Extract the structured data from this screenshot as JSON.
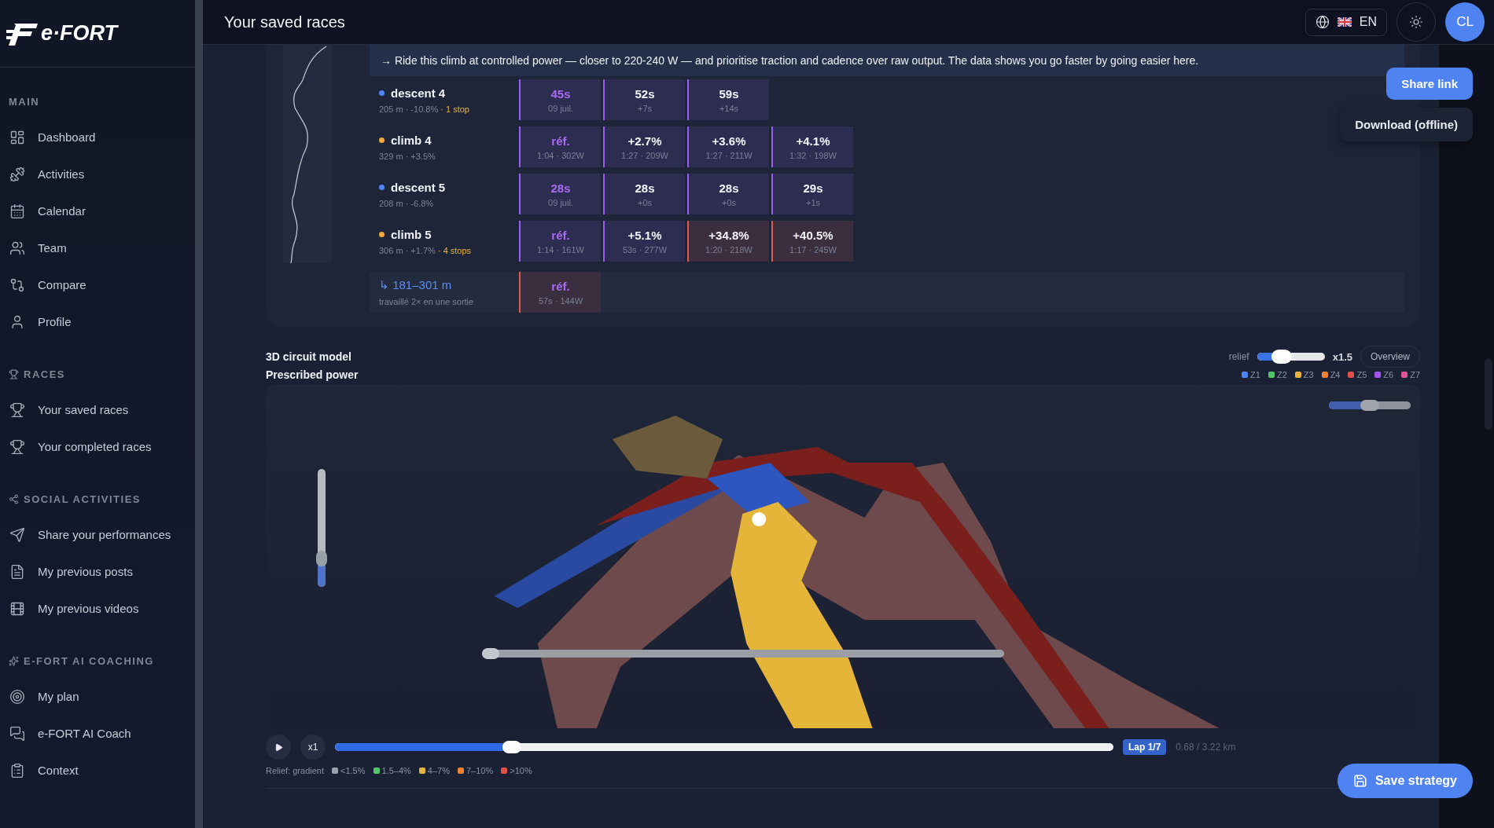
{
  "logo": "e·FORT",
  "header": {
    "title": "Your saved races",
    "language": "EN",
    "avatar": "CL"
  },
  "sidebar": {
    "sections": [
      {
        "title": "MAIN",
        "items": [
          {
            "label": "Dashboard"
          },
          {
            "label": "Activities"
          },
          {
            "label": "Calendar"
          },
          {
            "label": "Team"
          },
          {
            "label": "Compare"
          },
          {
            "label": "Profile"
          }
        ]
      },
      {
        "title": "RACES",
        "items": [
          {
            "label": "Your saved races"
          },
          {
            "label": "Your completed races"
          }
        ]
      },
      {
        "title": "SOCIAL ACTIVITIES",
        "items": [
          {
            "label": "Share your performances"
          },
          {
            "label": "My previous posts"
          },
          {
            "label": "My previous videos"
          }
        ]
      },
      {
        "title": "E-FORT AI COACHING",
        "items": [
          {
            "label": "My plan"
          },
          {
            "label": "e-FORT AI Coach"
          },
          {
            "label": "Context"
          }
        ]
      }
    ]
  },
  "advice": "→ Ride this climb at controlled power — closer to 220-240 W — and prioritise traction and cadence over raw output. The data shows you go faster by going easier here.",
  "segments": [
    {
      "kind": "segment",
      "name": "descent 4",
      "color": "#4f83f1",
      "meta": "205 m · -10.8%",
      "stops": "· 1 stop",
      "cells": [
        {
          "value": "45s",
          "sub": "09 juil.",
          "reference": true,
          "warning": false
        },
        {
          "value": "52s",
          "sub": "+7s",
          "reference": false,
          "warning": false
        },
        {
          "value": "59s",
          "sub": "+14s",
          "reference": false,
          "warning": false
        }
      ]
    },
    {
      "kind": "segment",
      "name": "climb 4",
      "color": "#f0a93b",
      "meta": "329 m · +3.5%",
      "cells": [
        {
          "value": "réf.",
          "sub": "1:04 · 302W",
          "reference": true,
          "warning": false
        },
        {
          "value": "+2.7%",
          "sub": "1:27 · 209W",
          "reference": false,
          "warning": false
        },
        {
          "value": "+3.6%",
          "sub": "1:27 · 211W",
          "reference": false,
          "warning": false
        },
        {
          "value": "+4.1%",
          "sub": "1:32 · 198W",
          "reference": false,
          "warning": false
        }
      ]
    },
    {
      "kind": "segment",
      "name": "descent 5",
      "color": "#4f83f1",
      "meta": "208 m · -6.8%",
      "cells": [
        {
          "value": "28s",
          "sub": "09 juil.",
          "reference": true,
          "warning": false
        },
        {
          "value": "28s",
          "sub": "+0s",
          "reference": false,
          "warning": false
        },
        {
          "value": "28s",
          "sub": "+0s",
          "reference": false,
          "warning": false
        },
        {
          "value": "29s",
          "sub": "+1s",
          "reference": false,
          "warning": false
        }
      ]
    },
    {
      "kind": "segment",
      "name": "climb 5",
      "color": "#f0a93b",
      "meta": "306 m · +1.7%",
      "stops": "· 4 stops",
      "cells": [
        {
          "value": "réf.",
          "sub": "1:14 · 161W",
          "reference": true,
          "warning": false
        },
        {
          "value": "+5.1%",
          "sub": "53s · 277W",
          "reference": false,
          "warning": false
        },
        {
          "value": "+34.8%",
          "sub": "1:20 · 218W",
          "reference": false,
          "warning": true
        },
        {
          "value": "+40.5%",
          "sub": "1:17 · 245W",
          "reference": false,
          "warning": true
        }
      ]
    },
    {
      "kind": "subrange",
      "name": "↳ 181–301 m",
      "meta": "travaillé 2× en une sortie",
      "cells": [
        {
          "value": "réf.",
          "sub": "57s · 144W",
          "reference": true,
          "warning": true
        }
      ]
    }
  ],
  "model": {
    "title": "3D circuit model",
    "relief": {
      "label": "relief",
      "level": 0.3,
      "reading": "x1.5"
    },
    "overview": "Overview",
    "power_title": "Prescribed power",
    "zones": [
      {
        "label": "Z1",
        "color": "#4f83f1"
      },
      {
        "label": "Z2",
        "color": "#52c46b"
      },
      {
        "label": "Z3",
        "color": "#e8b53c"
      },
      {
        "label": "Z4",
        "color": "#ef8132"
      },
      {
        "label": "Z5",
        "color": "#e2504b"
      },
      {
        "label": "Z6",
        "color": "#a455f0"
      },
      {
        "label": "Z7",
        "color": "#e0559b"
      }
    ],
    "camera_slider": {
      "level": 0.5
    },
    "height_slider": {
      "level": 0.2
    },
    "scrub_slider": {
      "level": 0
    },
    "playback": {
      "speed": "x1",
      "level": 0.22,
      "lap": "Lap 1/7",
      "distance": "0.68 / 3.22 km"
    },
    "legend_title": "Relief: gradient",
    "gradients": [
      {
        "label": "<1.5%",
        "color": "#9aa1ad"
      },
      {
        "label": "1.5–4%",
        "color": "#52c46b"
      },
      {
        "label": "4–7%",
        "color": "#e8b53c"
      },
      {
        "label": "7–10%",
        "color": "#ef8132"
      },
      {
        "label": ">10%",
        "color": "#e2504b"
      }
    ]
  },
  "actions": {
    "share": "Share link",
    "download": "Download (offline)",
    "save": "Save strategy"
  }
}
